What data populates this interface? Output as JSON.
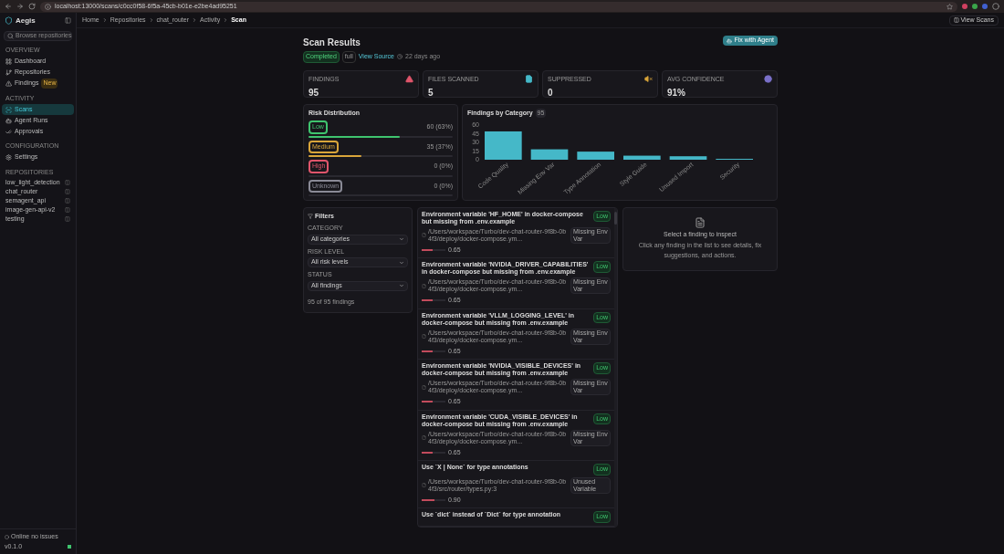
{
  "browser": {
    "url": "localhost:13000/scans/c0cc0f58-6f5a-45cb-b01e-e2be4ad95251"
  },
  "app": {
    "name": "Aegis"
  },
  "breadcrumbs": [
    "Home",
    "Repositories",
    "chat_router",
    "Activity",
    "Scan"
  ],
  "header_button": "View Scans",
  "sidebar": {
    "search_placeholder": "Browse repositories",
    "sections": [
      {
        "title": "OVERVIEW",
        "items": [
          {
            "label": "Dashboard",
            "selected": false
          },
          {
            "label": "Repositories",
            "selected": false
          },
          {
            "label": "Findings",
            "selected": false,
            "badge": "New"
          }
        ]
      },
      {
        "title": "ACTIVITY",
        "items": [
          {
            "label": "Scans",
            "selected": true
          },
          {
            "label": "Agent Runs",
            "selected": false
          },
          {
            "label": "Approvals",
            "selected": false
          }
        ]
      },
      {
        "title": "CONFIGURATION",
        "items": [
          {
            "label": "Settings",
            "selected": false
          }
        ]
      }
    ],
    "repos_title": "REPOSITORIES",
    "repos": [
      "low_light_detection",
      "chat_router",
      "semagent_api",
      "image-gen-api-v2",
      "testing"
    ],
    "status": "Online no issues",
    "version": "v0.1.0"
  },
  "scan": {
    "title": "Scan Results",
    "status": "Completed",
    "tag": "full",
    "source_link": "View Source",
    "time": "22 days ago",
    "fix_button": "Fix with Agent"
  },
  "stats": [
    {
      "label": "FINDINGS",
      "value": "95",
      "color": "#e0556b"
    },
    {
      "label": "FILES SCANNED",
      "value": "5",
      "color": "#45b8c8"
    },
    {
      "label": "SUPPRESSED",
      "value": "0",
      "color": "#d9a53a"
    },
    {
      "label": "AVG CONFIDENCE",
      "value": "91%",
      "color": "#7a70c8"
    }
  ],
  "risk": {
    "title": "Risk Distribution",
    "levels": [
      {
        "label": "Low",
        "reading": "60 (63%)",
        "level": 0.63,
        "color": "#3fc46e"
      },
      {
        "label": "Medium",
        "reading": "35 (37%)",
        "level": 0.37,
        "color": "#d9a53a"
      },
      {
        "label": "High",
        "reading": "0 (0%)",
        "level": 0,
        "color": "#e0556b"
      },
      {
        "label": "Unknown",
        "reading": "0 (0%)",
        "level": 0,
        "color": "#8a8a96"
      }
    ]
  },
  "categories": {
    "title": "Findings by Category",
    "count": "95",
    "chart_data": {
      "type": "bar",
      "categories": [
        "Code Quality",
        "Missing Env Var",
        "Type Annotation",
        "Style Guide",
        "Unused Import",
        "Security"
      ],
      "series": [
        {
          "color": "#45b8c8",
          "values": [
            49,
            18,
            14,
            7,
            6,
            1
          ]
        }
      ],
      "ylim": [
        0,
        60
      ],
      "yticks": [
        0,
        15,
        30,
        45,
        60
      ]
    }
  },
  "filters": {
    "title": "Filters",
    "fields": [
      {
        "label": "CATEGORY",
        "value": "All categories"
      },
      {
        "label": "RISK LEVEL",
        "value": "All risk levels"
      },
      {
        "label": "STATUS",
        "value": "All findings"
      }
    ],
    "count": "95 of 95 findings"
  },
  "findings": [
    {
      "title": "Environment variable 'HF_HOME' in docker-compose but missing from .env.example",
      "risk": "Low",
      "path": "/Users/workspace/Turbo/dev-chat-router-9f8b-0b4f3/deploy/docker-compose.ym...",
      "tag": "Missing Env Var",
      "level": 0.45,
      "score": "0.65"
    },
    {
      "title": "Environment variable 'NVIDIA_DRIVER_CAPABILITIES' in docker-compose but missing from .env.example",
      "risk": "Low",
      "path": "/Users/workspace/Turbo/dev-chat-router-9f8b-0b4f3/deploy/docker-compose.ym...",
      "tag": "Missing Env Var",
      "level": 0.45,
      "score": "0.65"
    },
    {
      "title": "Environment variable 'VLLM_LOGGING_LEVEL' in docker-compose but missing from .env.example",
      "risk": "Low",
      "path": "/Users/workspace/Turbo/dev-chat-router-9f8b-0b4f3/deploy/docker-compose.ym...",
      "tag": "Missing Env Var",
      "level": 0.45,
      "score": "0.65"
    },
    {
      "title": "Environment variable 'NVIDIA_VISIBLE_DEVICES' in docker-compose but missing from .env.example",
      "risk": "Low",
      "path": "/Users/workspace/Turbo/dev-chat-router-9f8b-0b4f3/deploy/docker-compose.ym...",
      "tag": "Missing Env Var",
      "level": 0.45,
      "score": "0.65"
    },
    {
      "title": "Environment variable 'CUDA_VISIBLE_DEVICES' in docker-compose but missing from .env.example",
      "risk": "Low",
      "path": "/Users/workspace/Turbo/dev-chat-router-9f8b-0b4f3/deploy/docker-compose.ym...",
      "tag": "Missing Env Var",
      "level": 0.45,
      "score": "0.65"
    },
    {
      "title": "Use `X | None` for type annotations",
      "risk": "Low",
      "path": "/Users/workspace/Turbo/dev-chat-router-9f8b-0b4f3/src/router/types.py:3",
      "tag": "Unused Variable",
      "level": 0.55,
      "score": "0.90"
    },
    {
      "title": "Use `dict` instead of `Dict` for type annotation",
      "risk": "Low"
    }
  ],
  "detail": {
    "title": "Select a finding to inspect",
    "text": "Click any finding in the list to see details, fix suggestions, and actions."
  }
}
